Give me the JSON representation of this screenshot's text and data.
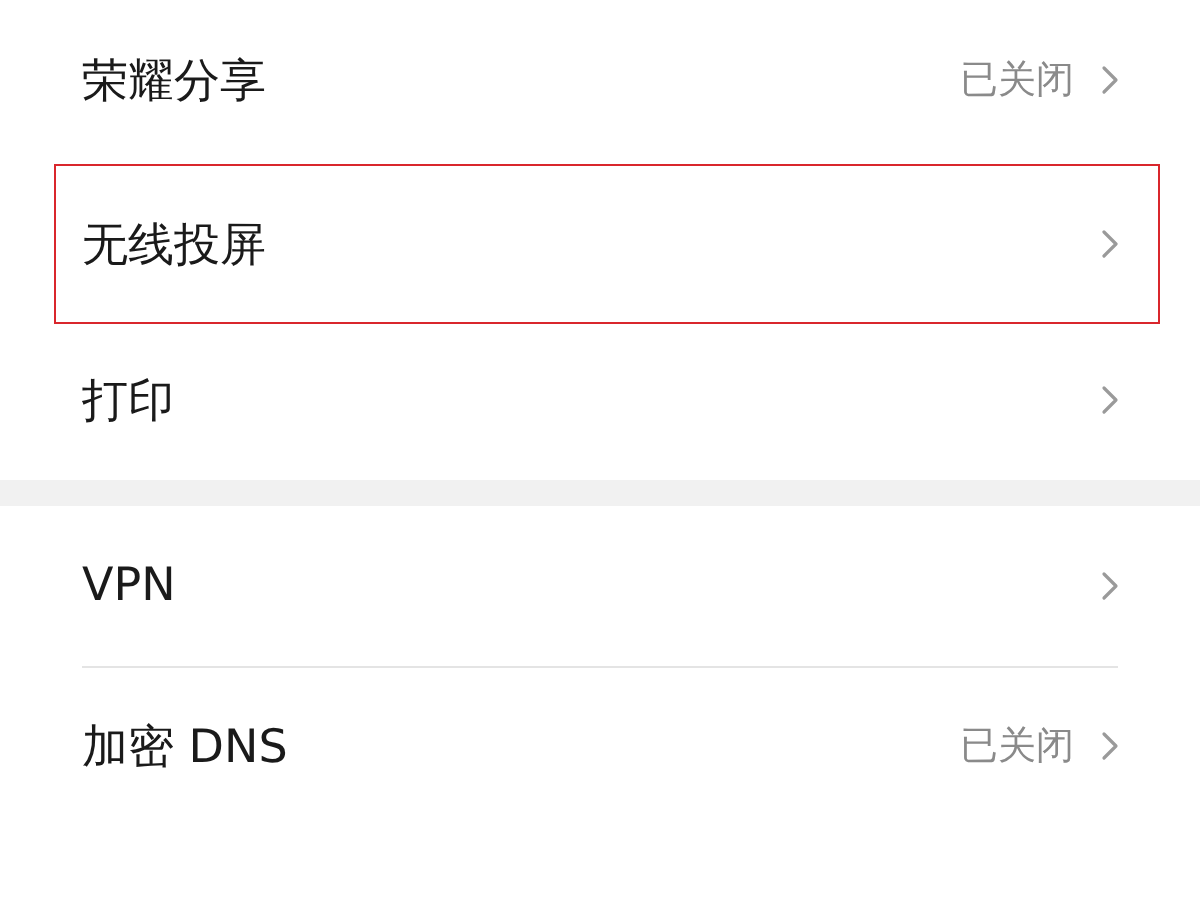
{
  "groups": [
    {
      "items": [
        {
          "label": "荣耀分享",
          "value": "已关闭",
          "highlighted": false
        },
        {
          "label": "无线投屏",
          "highlighted": true
        },
        {
          "label": "打印",
          "highlighted": false
        }
      ]
    },
    {
      "items": [
        {
          "label": "VPN",
          "highlighted": false
        },
        {
          "label": "加密 DNS",
          "value": "已关闭",
          "highlighted": false
        }
      ]
    }
  ]
}
